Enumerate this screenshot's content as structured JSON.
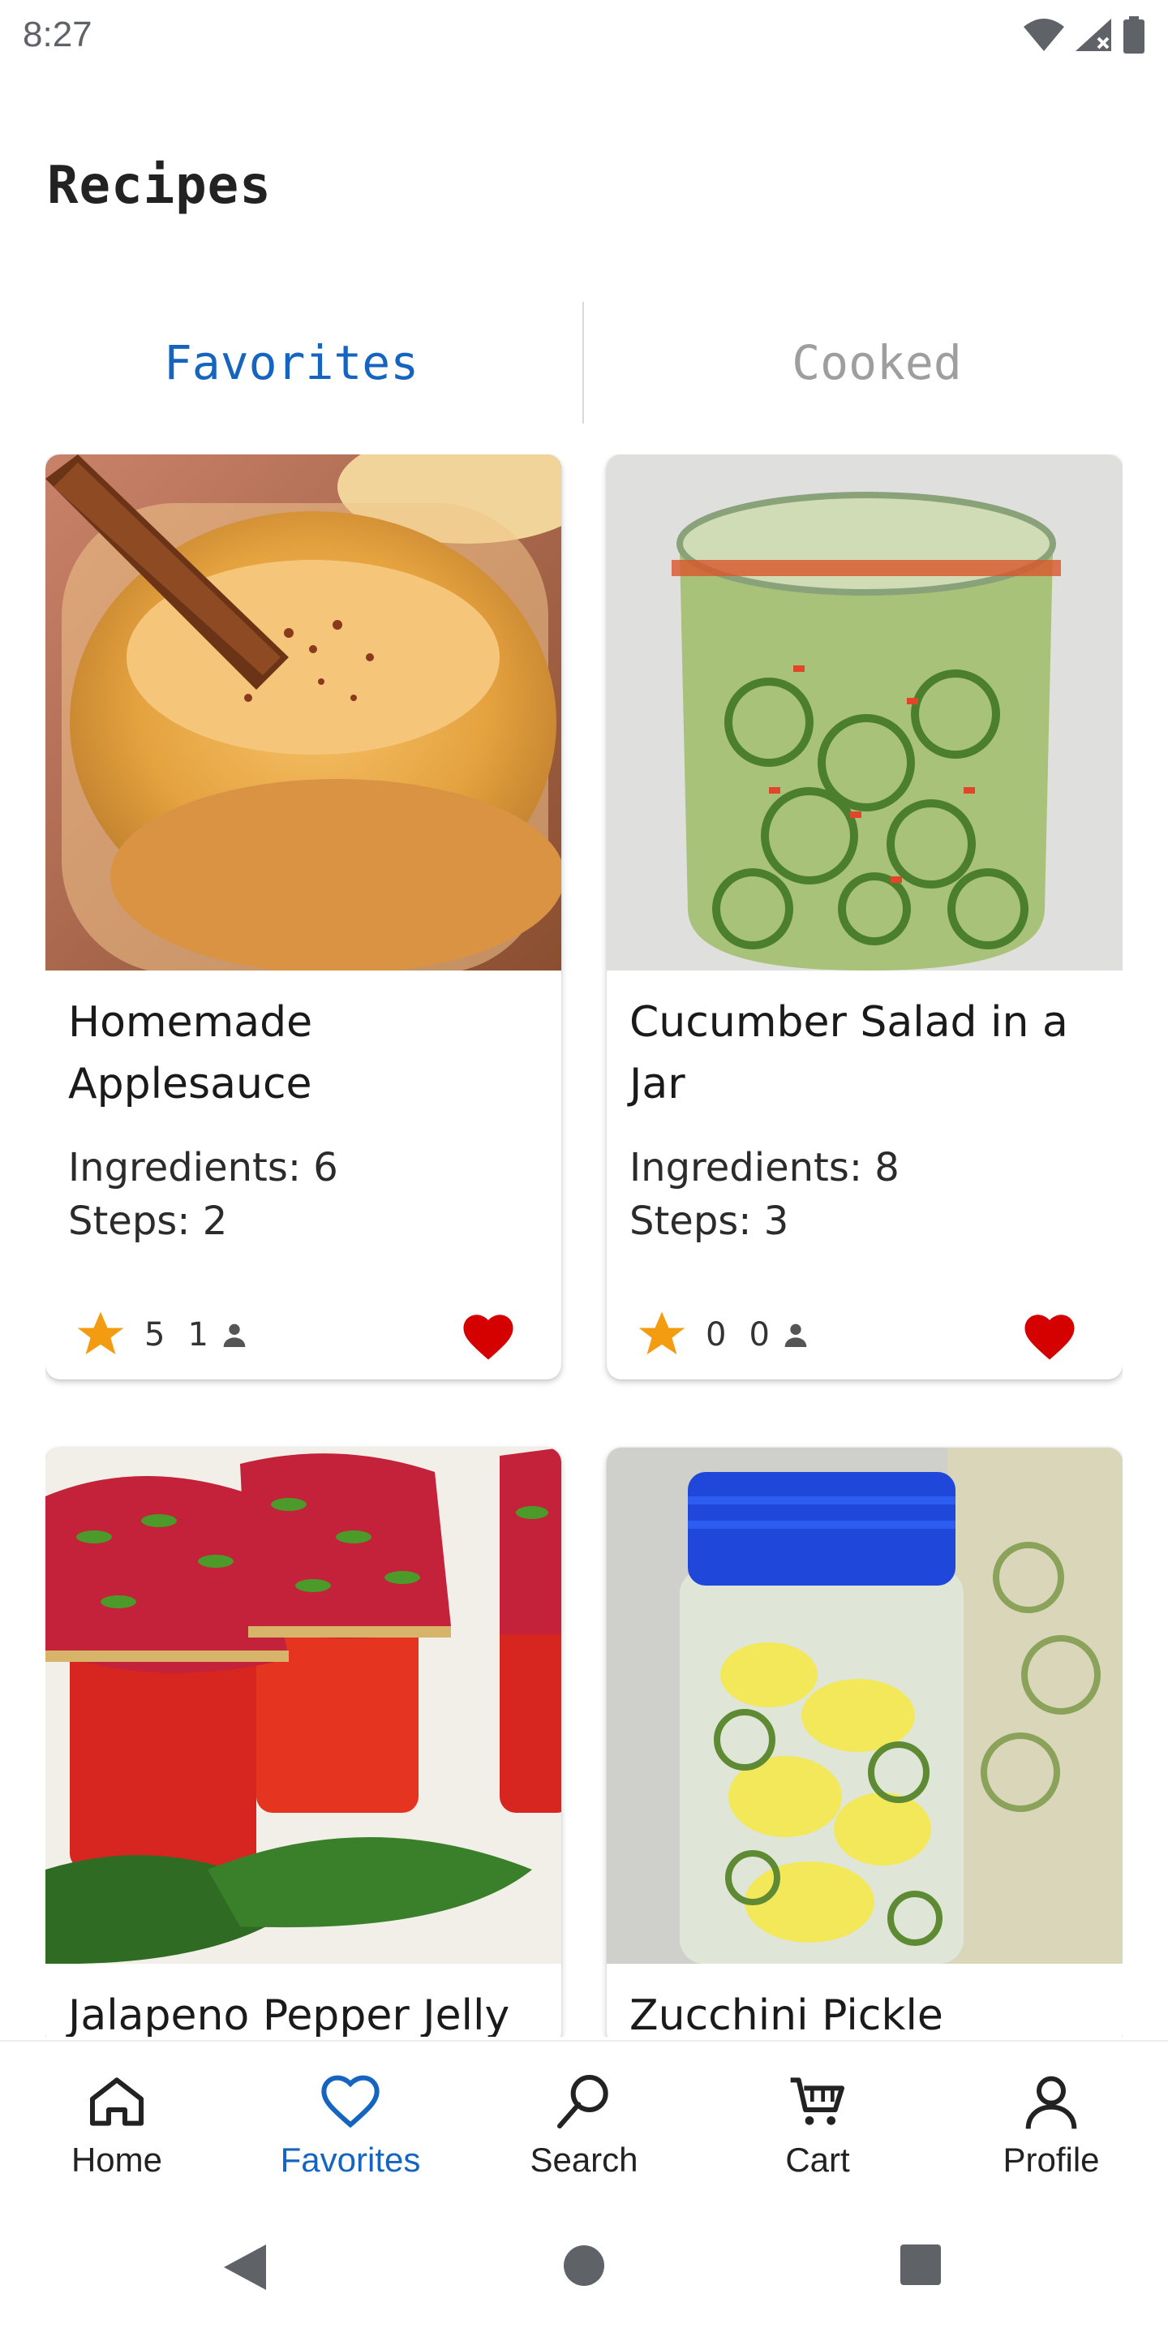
{
  "status_bar": {
    "time": "8:27"
  },
  "page": {
    "title": "Recipes"
  },
  "tabs": [
    {
      "label": "Favorites",
      "active": true
    },
    {
      "label": "Cooked",
      "active": false
    }
  ],
  "colors": {
    "accent": "#1565c0",
    "heart": "#d50000",
    "star": "#f39c12",
    "inactive_tab": "#9e9e9e"
  },
  "recipes": [
    {
      "title": "Homemade Applesauce",
      "ingredients": "Ingredients: 6",
      "steps": "Steps: 2",
      "rating": "5",
      "cooks": "1",
      "favorite": true
    },
    {
      "title": "Cucumber Salad in a Jar",
      "ingredients": "Ingredients: 8",
      "steps": "Steps: 3",
      "rating": "0",
      "cooks": "0",
      "favorite": true
    },
    {
      "title": "Jalapeno Pepper Jelly"
    },
    {
      "title": "Zucchini Pickle"
    }
  ],
  "bottom_nav": [
    {
      "label": "Home",
      "icon": "home-icon"
    },
    {
      "label": "Favorites",
      "icon": "heart-icon",
      "active": true
    },
    {
      "label": "Search",
      "icon": "search-icon"
    },
    {
      "label": "Cart",
      "icon": "cart-icon"
    },
    {
      "label": "Profile",
      "icon": "profile-icon"
    }
  ]
}
